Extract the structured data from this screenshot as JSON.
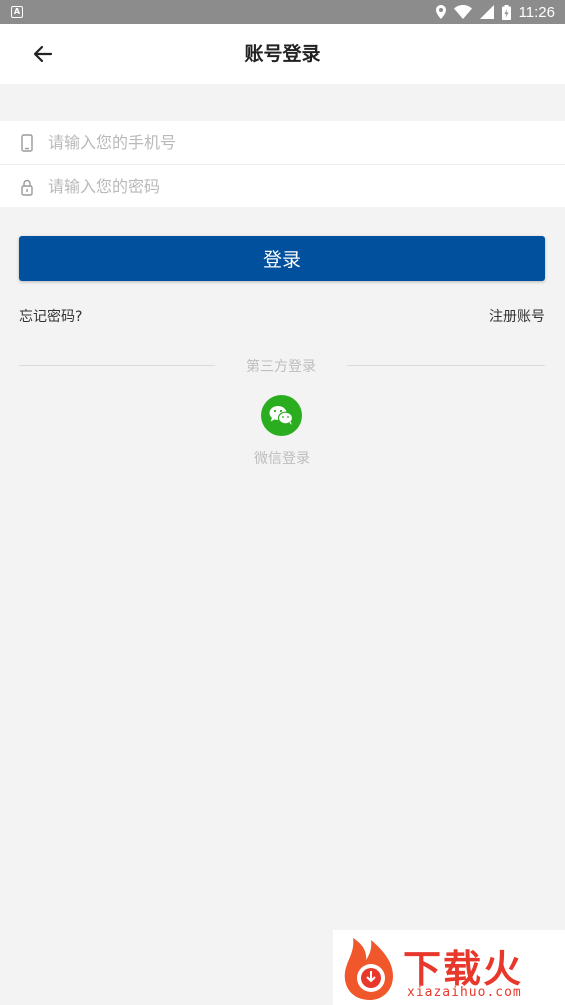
{
  "status_bar": {
    "time": "11:26"
  },
  "header": {
    "title": "账号登录"
  },
  "form": {
    "phone": {
      "value": "",
      "placeholder": "请输入您的手机号"
    },
    "password": {
      "value": "",
      "placeholder": "请输入您的密码"
    }
  },
  "actions": {
    "login_label": "登录",
    "forgot_label": "忘记密码?",
    "register_label": "注册账号"
  },
  "third_party": {
    "label": "第三方登录",
    "wechat_label": "微信登录"
  },
  "watermark": {
    "brand": "下载火",
    "site": "xiazaihuo.com"
  },
  "colors": {
    "primary": "#00509d",
    "wechat": "#2aae1f",
    "watermark": "#e8382c",
    "background": "#f3f3f3"
  },
  "icons": {
    "back": "arrow-left-icon",
    "phone": "phone-icon",
    "lock": "lock-icon",
    "wechat": "wechat-icon"
  }
}
